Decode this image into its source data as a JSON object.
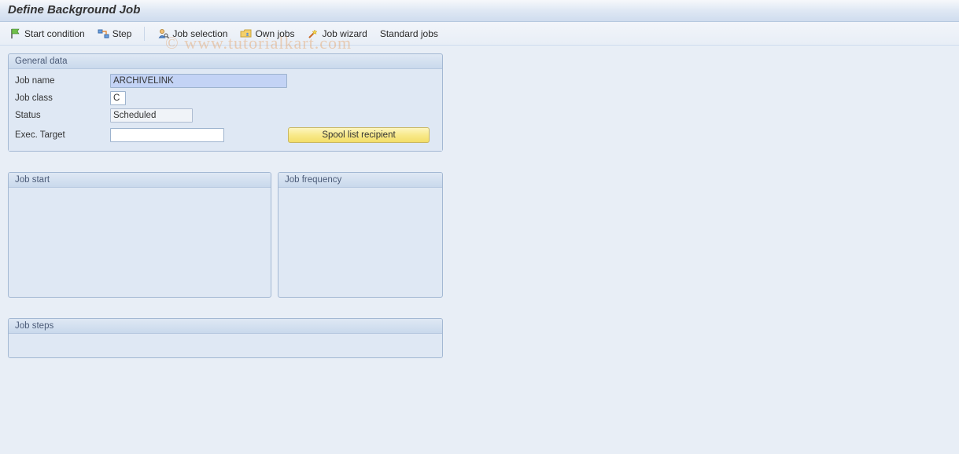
{
  "header": {
    "title": "Define Background Job"
  },
  "toolbar": {
    "start_condition": "Start condition",
    "step": "Step",
    "job_selection": "Job selection",
    "own_jobs": "Own jobs",
    "job_wizard": "Job wizard",
    "standard_jobs": "Standard jobs"
  },
  "general_data": {
    "title": "General data",
    "job_name_label": "Job name",
    "job_name_value": "ARCHIVELINK",
    "job_class_label": "Job class",
    "job_class_value": "C",
    "status_label": "Status",
    "status_value": "Scheduled",
    "exec_target_label": "Exec. Target",
    "exec_target_value": "",
    "spool_button": "Spool list recipient"
  },
  "job_start": {
    "title": "Job start"
  },
  "job_frequency": {
    "title": "Job frequency"
  },
  "job_steps": {
    "title": "Job steps"
  },
  "watermark": "© www.tutorialkart.com"
}
